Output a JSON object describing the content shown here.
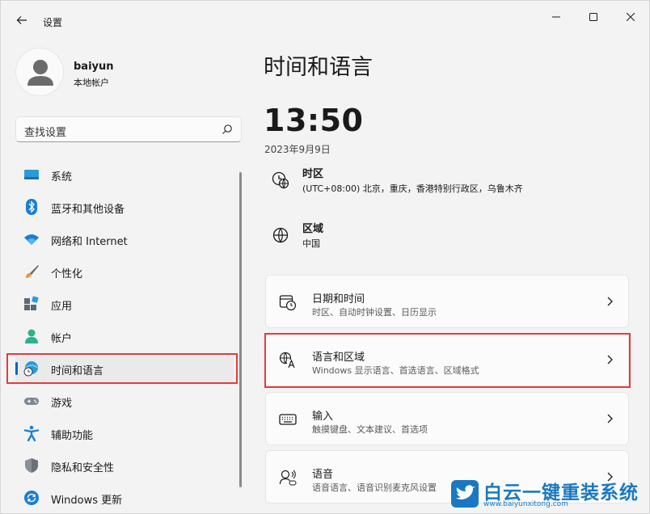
{
  "window": {
    "app_title": "设置",
    "controls": {
      "minimize": "minimize",
      "maximize": "maximize",
      "close": "close"
    }
  },
  "user": {
    "name": "baiyun",
    "account_type": "本地帐户"
  },
  "search": {
    "placeholder": "查找设置"
  },
  "sidebar": {
    "items": [
      {
        "label": "系统",
        "icon": "system-icon"
      },
      {
        "label": "蓝牙和其他设备",
        "icon": "bluetooth-icon"
      },
      {
        "label": "网络和 Internet",
        "icon": "wifi-icon"
      },
      {
        "label": "个性化",
        "icon": "brush-icon"
      },
      {
        "label": "应用",
        "icon": "apps-icon"
      },
      {
        "label": "帐户",
        "icon": "person-icon"
      },
      {
        "label": "时间和语言",
        "icon": "globe-clock-icon",
        "selected": true
      },
      {
        "label": "游戏",
        "icon": "gamepad-icon"
      },
      {
        "label": "辅助功能",
        "icon": "accessibility-icon"
      },
      {
        "label": "隐私和安全性",
        "icon": "shield-icon"
      },
      {
        "label": "Windows 更新",
        "icon": "update-icon"
      }
    ]
  },
  "main": {
    "title": "时间和语言",
    "clock": "13:50",
    "date": "2023年9月9日",
    "info": [
      {
        "title": "时区",
        "subtitle": "(UTC+08:00) 北京，重庆，香港特别行政区，乌鲁木齐",
        "icon": "timezone-icon"
      },
      {
        "title": "区域",
        "subtitle": "中国",
        "icon": "globe-icon"
      }
    ],
    "cards": [
      {
        "title": "日期和时间",
        "subtitle": "时区、自动时钟设置、日历显示",
        "icon": "calendar-clock-icon"
      },
      {
        "title": "语言和区域",
        "subtitle": "Windows 显示语言、首选语言、区域格式",
        "icon": "language-icon",
        "highlighted": true
      },
      {
        "title": "输入",
        "subtitle": "触摸键盘、文本建议、首选项",
        "icon": "keyboard-icon"
      },
      {
        "title": "语音",
        "subtitle": "语音语言、语音识别麦克风设置",
        "icon": "speech-icon"
      }
    ]
  },
  "watermark": {
    "title": "白云一键重装系统",
    "url": "www.baiyunxitong.com"
  },
  "colors": {
    "accent": "#0067c0",
    "highlight_border": "#e23c3c",
    "watermark": "#1a78c2"
  }
}
